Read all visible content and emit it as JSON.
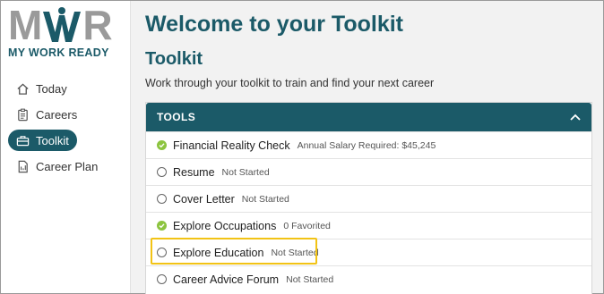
{
  "logo": {
    "letter_m": "M",
    "letter_w": "W",
    "letter_r": "R",
    "tagline": "MY WORK READY"
  },
  "nav": {
    "items": [
      {
        "label": "Today",
        "icon": "home-icon"
      },
      {
        "label": "Careers",
        "icon": "clipboard-icon"
      },
      {
        "label": "Toolkit",
        "icon": "toolbox-icon",
        "active": true
      },
      {
        "label": "Career Plan",
        "icon": "document-icon"
      }
    ]
  },
  "main": {
    "title": "Welcome to your Toolkit",
    "section_title": "Toolkit",
    "section_desc": "Work through your toolkit to train and find your next career"
  },
  "tools": {
    "header": "TOOLS",
    "items": [
      {
        "label": "Financial Reality Check",
        "status": "Annual Salary Required: $45,245",
        "done": true
      },
      {
        "label": "Resume",
        "status": "Not Started",
        "done": false
      },
      {
        "label": "Cover Letter",
        "status": "Not Started",
        "done": false
      },
      {
        "label": "Explore Occupations",
        "status": "0 Favorited",
        "done": true
      },
      {
        "label": "Explore Education",
        "status": "Not Started",
        "done": false
      },
      {
        "label": "Career Advice Forum",
        "status": "Not Started",
        "done": false
      }
    ]
  },
  "colors": {
    "brand": "#1b5a68",
    "done": "#8cc43f",
    "highlight": "#f2c315",
    "logo_gray": "#9a9a9a"
  }
}
